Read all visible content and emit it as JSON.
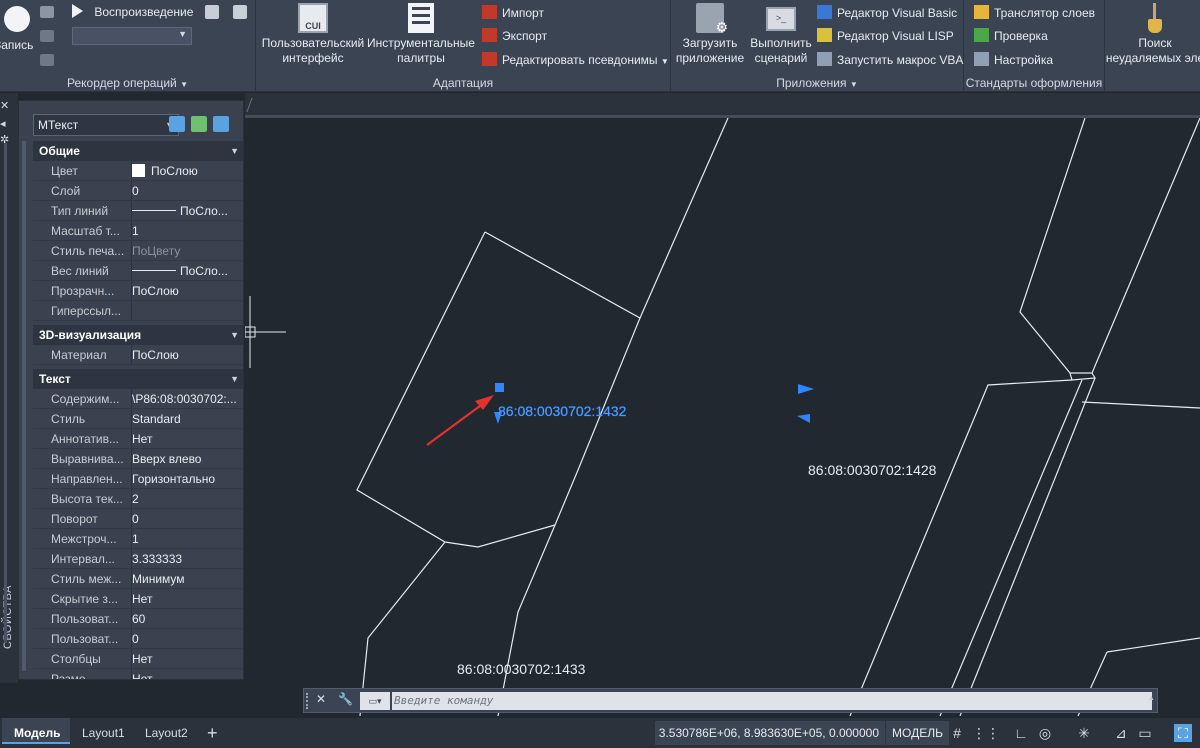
{
  "ribbon": {
    "recorder": {
      "record_label": "Запись",
      "play_label": "Воспроизведение",
      "title": "Рекордер операций"
    },
    "adapt": {
      "cui_label_1": "Пользовательский",
      "cui_label_2": "интерфейс",
      "cui_icon_text": "CUI",
      "tools_label_1": "Инструментальные",
      "tools_label_2": "палитры",
      "import_label": "Импорт",
      "export_label": "Экспорт",
      "aliases_label": "Редактировать псевдонимы",
      "title": "Адаптация"
    },
    "apps": {
      "load_label_1": "Загрузить",
      "load_label_2": "приложение",
      "run_label_1": "Выполнить",
      "run_label_2": "сценарий",
      "vb_label": "Редактор Visual Basic",
      "lisp_label": "Редактор Visual LISP",
      "vba_label": "Запустить макрос VBA",
      "title": "Приложения"
    },
    "standards": {
      "translator_label": "Транслятор  слоев",
      "check_label": "Проверка",
      "setup_label": "Настройка",
      "title": "Стандарты оформления"
    },
    "purge": {
      "label_1": "Поиск",
      "label_2": "неудаляемых эле"
    }
  },
  "properties": {
    "object_type": "МТекст",
    "sections": [
      {
        "title": "Общие",
        "rows": [
          {
            "name": "Цвет",
            "value": "ПоСлою"
          },
          {
            "name": "Слой",
            "value": "0"
          },
          {
            "name": "Тип линий",
            "value": "ПоСло..."
          },
          {
            "name": "Масштаб т...",
            "value": "1"
          },
          {
            "name": "Стиль печа...",
            "value": "ПоЦвету"
          },
          {
            "name": "Вес линий",
            "value": "ПоСло..."
          },
          {
            "name": "Прозрачн...",
            "value": "ПоСлою"
          },
          {
            "name": "Гиперссыл...",
            "value": ""
          }
        ]
      },
      {
        "title": "3D-визуализация",
        "rows": [
          {
            "name": "Материал",
            "value": "ПоСлою"
          }
        ]
      },
      {
        "title": "Текст",
        "rows": [
          {
            "name": "Содержим...",
            "value": "\\P86:08:0030702:..."
          },
          {
            "name": "Стиль",
            "value": "Standard"
          },
          {
            "name": "Аннотатив...",
            "value": "Нет"
          },
          {
            "name": "Выравнива...",
            "value": "Вверх влево"
          },
          {
            "name": "Направлен...",
            "value": "Горизонтально"
          },
          {
            "name": "Высота тек...",
            "value": "2"
          },
          {
            "name": "Поворот",
            "value": "0"
          },
          {
            "name": "Межстроч...",
            "value": "1"
          },
          {
            "name": "Интервал...",
            "value": "3.333333"
          },
          {
            "name": "Стиль меж...",
            "value": "Минимум"
          },
          {
            "name": "Скрытие з...",
            "value": "Нет"
          },
          {
            "name": "Пользоват...",
            "value": "60"
          },
          {
            "name": "Пользоват...",
            "value": "0"
          },
          {
            "name": "Столбцы",
            "value": "Нет"
          },
          {
            "name": "Разме...",
            "value": "Нет"
          }
        ]
      }
    ],
    "side_label": "СВОЙСТВА"
  },
  "drawing": {
    "label_selected": "86:08:0030702:1432",
    "label_1428": "86:08:0030702:1428",
    "label_1433": "86:08:0030702:1433"
  },
  "command": {
    "placeholder": "Введите команду"
  },
  "status": {
    "tabs": [
      "Модель",
      "Layout1",
      "Layout2"
    ],
    "add_tab": "+",
    "coordinates": "3.530786E+06, 8.983630E+05, 0.000000",
    "model_label": "МОДЕЛЬ"
  },
  "colors": {
    "accent_selection": "#2f86ff",
    "arrow": "#e5312b",
    "background": "#212830"
  }
}
